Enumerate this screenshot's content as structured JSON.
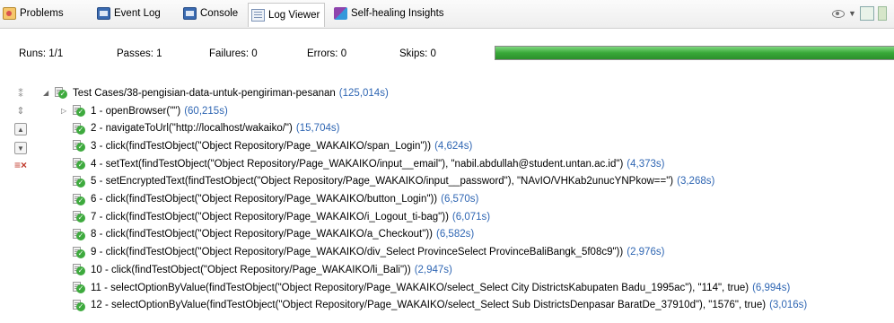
{
  "tabs": [
    {
      "label": "Problems",
      "icon": "problems-icon",
      "active": false
    },
    {
      "label": "Event Log",
      "icon": "event-log-icon",
      "active": false
    },
    {
      "label": "Console",
      "icon": "console-icon",
      "active": false
    },
    {
      "label": "Log Viewer",
      "icon": "log-viewer-icon",
      "active": true
    },
    {
      "label": "Self-healing Insights",
      "icon": "self-healing-icon",
      "active": false
    }
  ],
  "stats": {
    "runs": "Runs: 1/1",
    "passes": "Passes: 1",
    "failures": "Failures: 0",
    "errors": "Errors: 0",
    "skips": "Skips: 0"
  },
  "progress": {
    "fraction": 1.0,
    "color": "#38a838"
  },
  "tree": {
    "root": {
      "label": "Test Cases/38-pengisian-data-untuk-pengiriman-pesanan",
      "duration": "(125,014s)"
    },
    "steps": [
      {
        "label": "1 - openBrowser(\"\")",
        "duration": "(60,215s)",
        "expandable": true
      },
      {
        "label": "2 - navigateToUrl(\"http://localhost/wakaiko/\")",
        "duration": "(15,704s)"
      },
      {
        "label": "3 - click(findTestObject(\"Object Repository/Page_WAKAIKO/span_Login\"))",
        "duration": "(4,624s)"
      },
      {
        "label": "4 - setText(findTestObject(\"Object Repository/Page_WAKAIKO/input__email\"), \"nabil.abdullah@student.untan.ac.id\")",
        "duration": "(4,373s)"
      },
      {
        "label": "5 - setEncryptedText(findTestObject(\"Object Repository/Page_WAKAIKO/input__password\"), \"NAvIO/VHKab2unucYNPkow==\")",
        "duration": "(3,268s)"
      },
      {
        "label": "6 - click(findTestObject(\"Object Repository/Page_WAKAIKO/button_Login\"))",
        "duration": "(6,570s)"
      },
      {
        "label": "7 - click(findTestObject(\"Object Repository/Page_WAKAIKO/i_Logout_ti-bag\"))",
        "duration": "(6,071s)"
      },
      {
        "label": "8 - click(findTestObject(\"Object Repository/Page_WAKAIKO/a_Checkout\"))",
        "duration": "(6,582s)"
      },
      {
        "label": "9 - click(findTestObject(\"Object Repository/Page_WAKAIKO/div_Select ProvinceSelect ProvinceBaliBangk_5f08c9\"))",
        "duration": "(2,976s)"
      },
      {
        "label": "10 - click(findTestObject(\"Object Repository/Page_WAKAIKO/li_Bali\"))",
        "duration": "(2,947s)"
      },
      {
        "label": "11 - selectOptionByValue(findTestObject(\"Object Repository/Page_WAKAIKO/select_Select City  DistrictsKabupaten Badu_1995ac\"), \"114\", true)",
        "duration": "(6,994s)"
      },
      {
        "label": "12 - selectOptionByValue(findTestObject(\"Object Repository/Page_WAKAIKO/select_Select Sub DistrictsDenpasar BaratDe_37910d\"), \"1576\", true)",
        "duration": "(3,016s)"
      }
    ]
  }
}
